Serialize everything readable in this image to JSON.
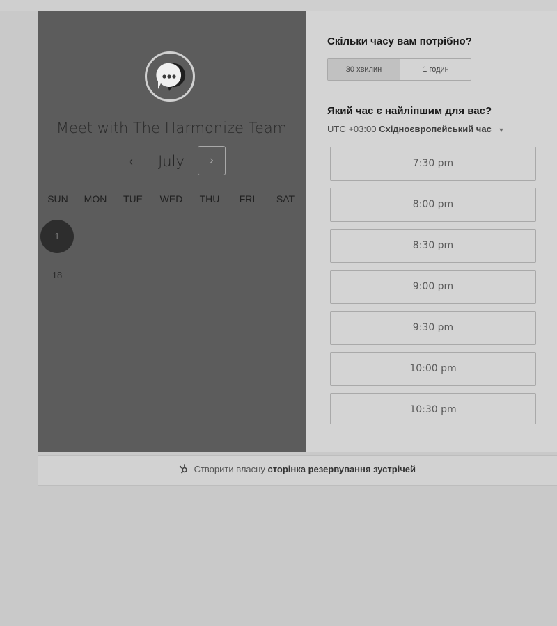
{
  "host": {
    "name": "Meet with The Harmonize Team",
    "avatar_icon": "chat-bubble-icon"
  },
  "calendar": {
    "month": "July",
    "prev_icon": "‹",
    "next_icon": "›",
    "weekdays": [
      "SUN",
      "MON",
      "TUE",
      "WED",
      "THU",
      "FRI",
      "SAT"
    ],
    "days": [
      {
        "label": "1",
        "state": "selected"
      },
      {
        "label": "18",
        "state": "available"
      }
    ]
  },
  "duration": {
    "question": "Скільки часу вам потрібно?",
    "options": [
      "30 хвилин",
      "1 годин"
    ],
    "selected": "30 хвилин"
  },
  "time": {
    "question": "Який час є найліпшим для вас?",
    "tz_offset": "UTC +03:00",
    "tz_name": "Східноєвропейський час",
    "slots": [
      "7:30 pm",
      "8:00 pm",
      "8:30 pm",
      "9:00 pm",
      "9:30 pm",
      "10:00 pm",
      "10:30 pm"
    ]
  },
  "footer": {
    "prefix": "Створити власну",
    "link": "сторінка резервування зустрічей"
  },
  "colors": {
    "left_panel": "#5c5c5c",
    "right_panel": "#d4d4d4",
    "selected_day": "#2d2d2d"
  }
}
